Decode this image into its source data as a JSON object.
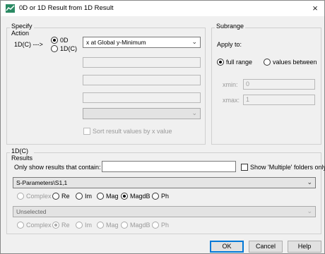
{
  "window": {
    "title": "0D or 1D Result from 1D Result",
    "close": "×"
  },
  "specify_action": {
    "legend": "Specify Action",
    "source_label": "1D(C) --->",
    "radio_0d": "0D",
    "radio_1dc": "1D(C)",
    "action_combo": "x at Global y-Minimum",
    "sort_checkbox": "Sort result values by x value"
  },
  "subrange": {
    "legend": "Subrange",
    "apply_to": "Apply to:",
    "full_range": "full range",
    "values_between": "values between",
    "xmin_label": "xmin:",
    "xmin_value": "0",
    "xmax_label": "xmax:",
    "xmax_value": "1"
  },
  "results": {
    "legend": "1D(C) Results",
    "filter_label": "Only show results that contain:",
    "filter_value": "",
    "show_multiple": "Show 'Multiple' folders only",
    "result1_combo": "S-Parameters\\S1,1",
    "result2_combo": "Unselected",
    "opts": {
      "complex": "Complex",
      "re": "Re",
      "im": "Im",
      "mag": "Mag",
      "magdb": "MagdB",
      "ph": "Ph"
    }
  },
  "buttons": {
    "ok": "OK",
    "cancel": "Cancel",
    "help": "Help"
  },
  "colors": {
    "accent": "#0078d7",
    "dialog_bg": "#f0f0f0"
  }
}
